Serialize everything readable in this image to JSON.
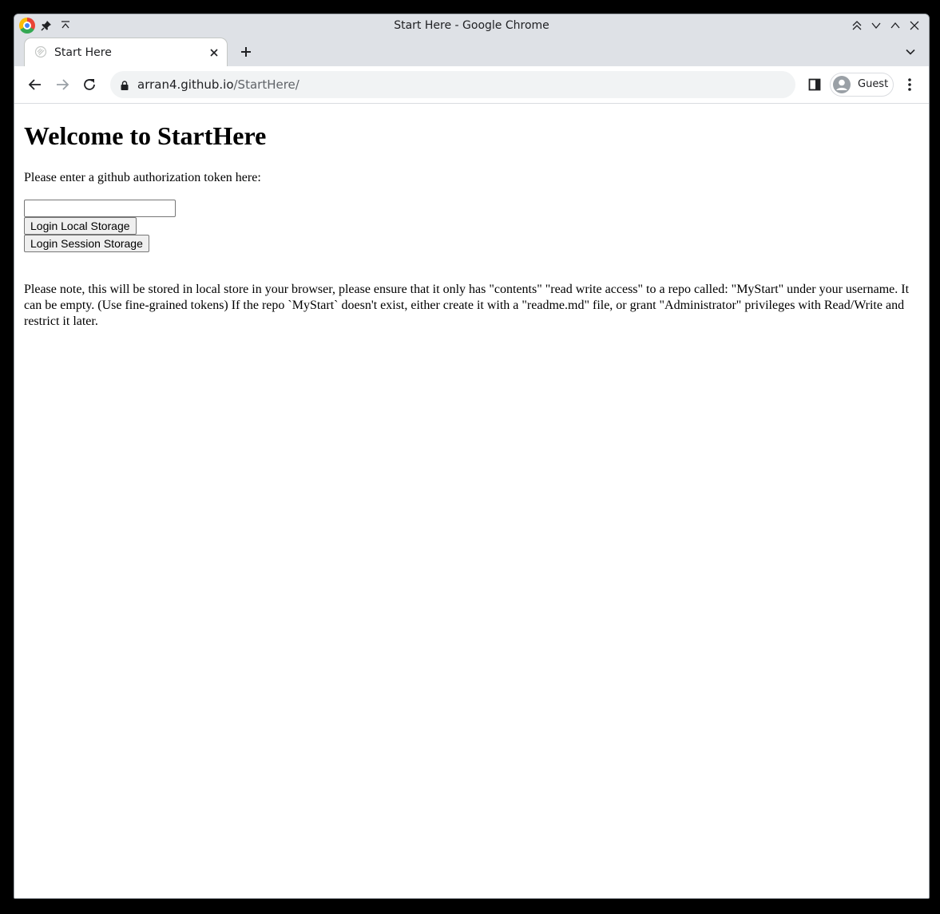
{
  "window": {
    "title": "Start Here - Google Chrome"
  },
  "tabs": [
    {
      "label": "Start Here",
      "favicon": "generic-page-icon"
    }
  ],
  "toolbar": {
    "url_host": "arran4.github.io",
    "url_path": "/StartHere/",
    "profile_name": "Guest"
  },
  "page": {
    "heading": "Welcome to StartHere",
    "prompt": "Please enter a github authorization token here:",
    "token_input_value": "",
    "login_local_label": "Login Local Storage",
    "login_session_label": "Login Session Storage",
    "note": "Please note, this will be stored in local store in your browser, please ensure that it only has \"contents\" \"read write access\" to a repo called: \"MyStart\" under your username. It can be empty. (Use fine-grained tokens) If the repo `MyStart` doesn't exist, either create it with a \"readme.md\" file, or grant \"Administrator\" privileges with Read/Write and restrict it later."
  },
  "colors": {
    "chrome_frame": "#dee1e6",
    "omnibox_bg": "#f1f3f4",
    "page_bg": "#ffffff"
  }
}
